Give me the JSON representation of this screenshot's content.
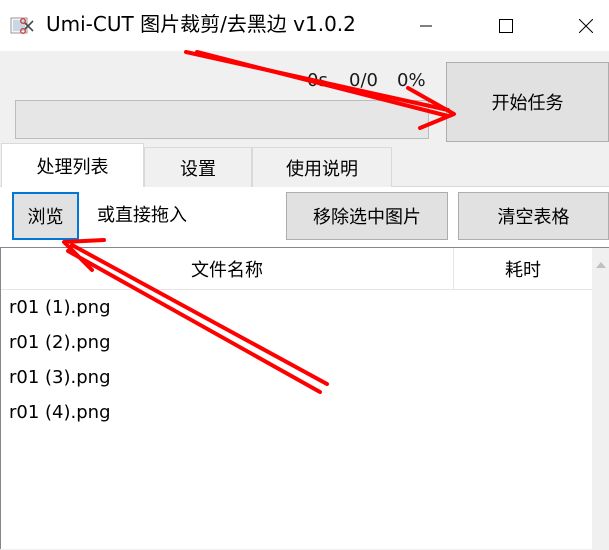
{
  "window": {
    "title": "Umi-CUT 图片裁剪/去黑边 v1.0.2"
  },
  "status": {
    "elapsed": "0s",
    "count": "0/0",
    "percent": "0%",
    "progress_fraction": 0
  },
  "actions": {
    "start_label": "开始任务",
    "browse_label": "浏览",
    "drag_hint": "或直接拖入",
    "remove_label": "移除选中图片",
    "clear_label": "清空表格"
  },
  "tabs": [
    {
      "label": "处理列表",
      "active": true
    },
    {
      "label": "设置",
      "active": false
    },
    {
      "label": "使用说明",
      "active": false
    }
  ],
  "table": {
    "columns": [
      "文件名称",
      "耗时"
    ],
    "rows": [
      {
        "name": "r01 (1).png",
        "time": ""
      },
      {
        "name": "r01 (2).png",
        "time": ""
      },
      {
        "name": "r01 (3).png",
        "time": ""
      },
      {
        "name": "r01 (4).png",
        "time": ""
      }
    ]
  },
  "colors": {
    "annotation_arrow": "#ff0000",
    "focus_border": "#0078d7"
  }
}
